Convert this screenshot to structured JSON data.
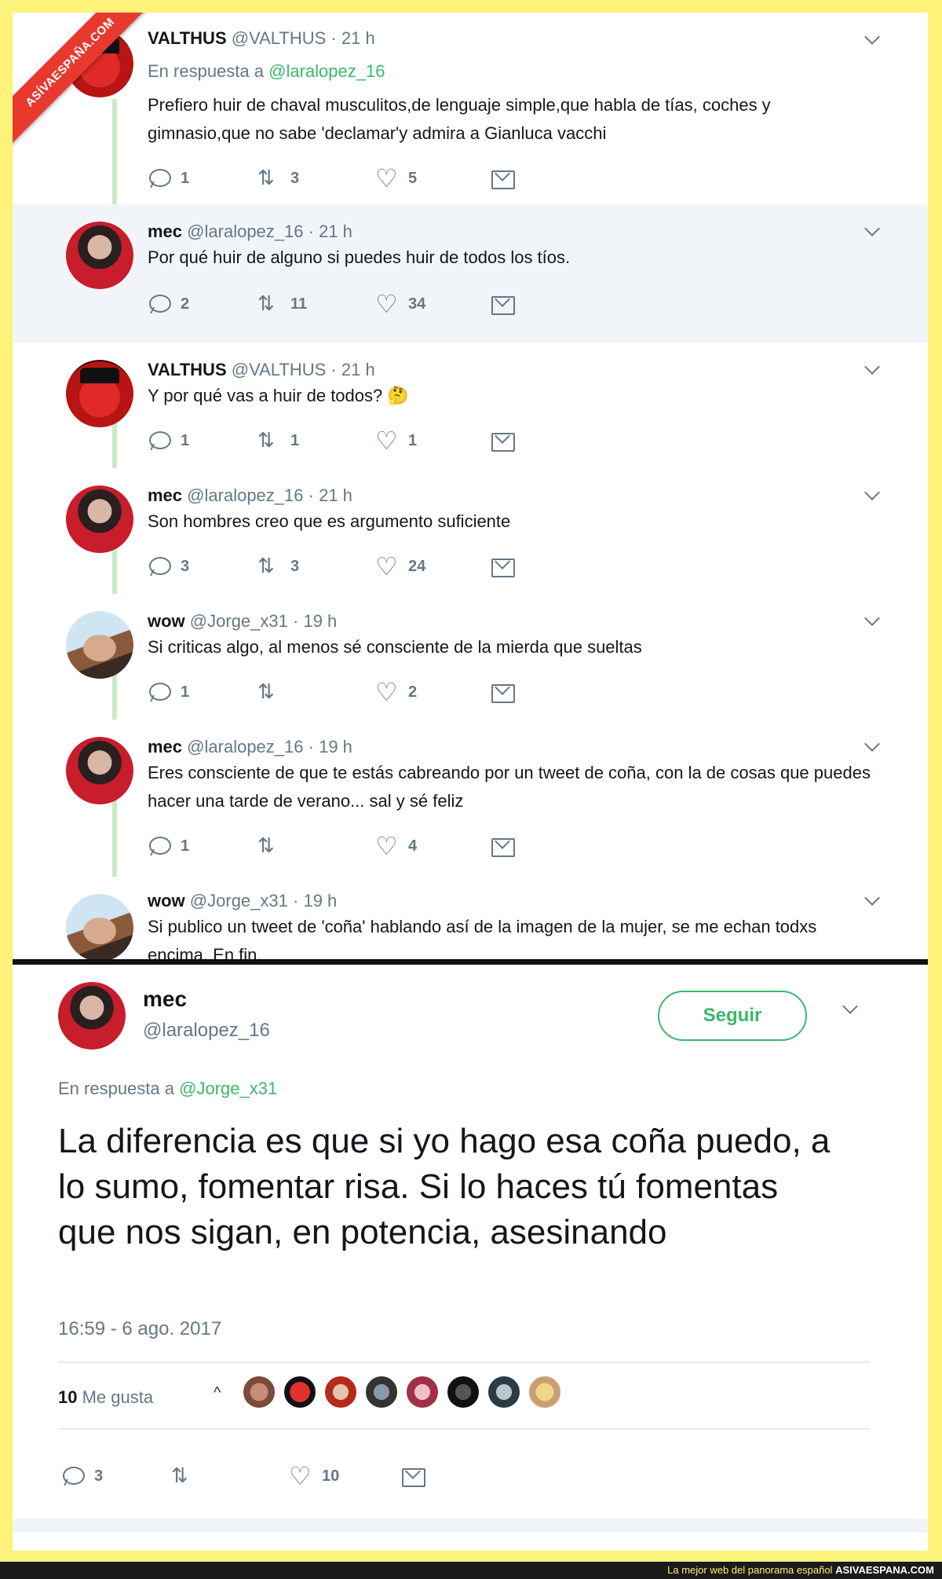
{
  "thread": [
    {
      "name": "VALTHUS",
      "handle": "@VALTHUS",
      "time": "21 h",
      "reply_to_label": "En respuesta a",
      "reply_to_handle": "@laralopez_16",
      "text": "Prefiero huir de chaval musculitos,de lenguaje simple,que habla de tías, coches y gimnasio,que no sabe  'declamar'y admira a Gianluca vacchi",
      "replies": "1",
      "retweets": "3",
      "likes": "5",
      "avatar": "valthus-avatar"
    },
    {
      "name": "mec",
      "handle": "@laralopez_16",
      "time": "21 h",
      "text": "Por qué huir de alguno si puedes huir de todos los tíos.",
      "replies": "2",
      "retweets": "11",
      "likes": "34",
      "avatar": "mec-avatar"
    },
    {
      "name": "VALTHUS",
      "handle": "@VALTHUS",
      "time": "21 h",
      "text": "Y por qué vas a huir de todos? 🤔",
      "replies": "1",
      "retweets": "1",
      "likes": "1",
      "avatar": "valthus-avatar"
    },
    {
      "name": "mec",
      "handle": "@laralopez_16",
      "time": "21 h",
      "text": "Son hombres creo que es argumento suficiente",
      "replies": "3",
      "retweets": "3",
      "likes": "24",
      "avatar": "mec-avatar"
    },
    {
      "name": "wow",
      "handle": "@Jorge_x31",
      "time": "19 h",
      "text": "Si criticas algo,  al menos sé consciente de la mierda que sueltas",
      "replies": "1",
      "retweets": "",
      "likes": "2",
      "avatar": "wow-avatar"
    },
    {
      "name": "mec",
      "handle": "@laralopez_16",
      "time": "19 h",
      "text": "Eres consciente de que te estás cabreando por un tweet de coña, con la de cosas que puedes hacer una tarde de verano... sal y sé feliz",
      "replies": "1",
      "retweets": "",
      "likes": "4",
      "avatar": "mec-avatar"
    },
    {
      "name": "wow",
      "handle": "@Jorge_x31",
      "time": "19 h",
      "text": "Si publico un tweet de 'coña' hablando así de la imagen de la mujer, se me echan todxs encima. En fin.",
      "avatar": "wow-avatar"
    }
  ],
  "main_tweet": {
    "name": "mec",
    "handle": "@laralopez_16",
    "follow_label": "Seguir",
    "reply_to_label": "En respuesta a",
    "reply_to_handle": "@Jorge_x31",
    "text": "La diferencia es que si yo hago esa coña puedo, a lo sumo, fomentar risa. Si lo haces tú fomentas que nos sigan, en potencia, asesinando",
    "timestamp": "16:59 - 6 ago. 2017",
    "likes_count": "10",
    "likes_label": "Me gusta",
    "replies": "3",
    "retweets": "",
    "likes": "10"
  },
  "watermark": {
    "ribbon": "ASÍVAESPAÑA.COM",
    "footer_text": "La mejor web del panorama español",
    "footer_site": "ASIVAESPANA.COM"
  },
  "colors": {
    "accent": "#3bb86a",
    "frame": "#fdf27a",
    "ribbon": "#e8392f"
  }
}
